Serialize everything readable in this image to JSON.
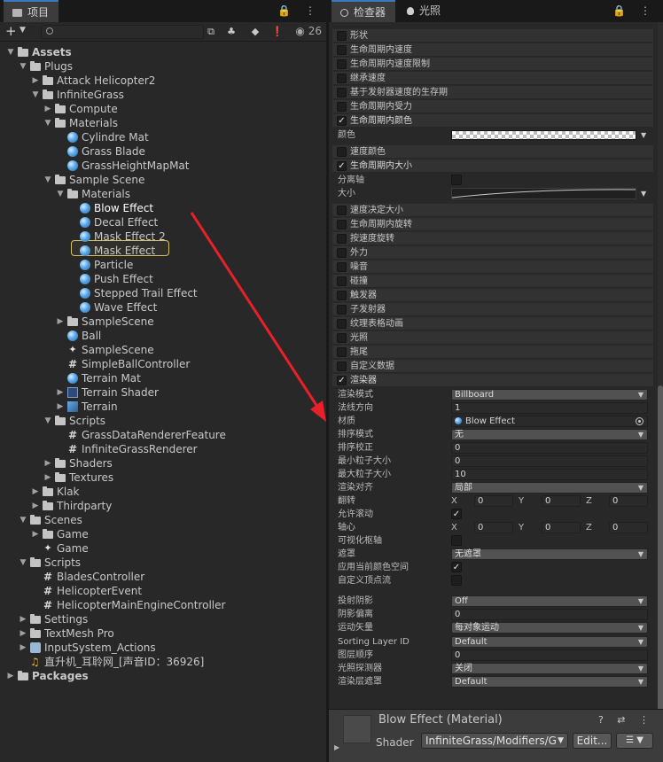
{
  "project": {
    "tab_label": "项目",
    "menu_glyphs": "🔒 ⋮",
    "search_placeholder": "",
    "eye_count": "26",
    "tree": [
      {
        "label": "Assets"
      },
      {
        "label": "Plugs"
      },
      {
        "label": "Attack Helicopter2"
      },
      {
        "label": "InfiniteGrass"
      },
      {
        "label": "Compute"
      },
      {
        "label": "Materials"
      },
      {
        "label": "Cylindre Mat"
      },
      {
        "label": "Grass Blade"
      },
      {
        "label": "GrassHeightMapMat"
      },
      {
        "label": "Sample Scene"
      },
      {
        "label": "Materials"
      },
      {
        "label": "Blow Effect"
      },
      {
        "label": "Decal Effect"
      },
      {
        "label": "Mask Effect 2"
      },
      {
        "label": "Mask Effect"
      },
      {
        "label": "Particle"
      },
      {
        "label": "Push Effect"
      },
      {
        "label": "Stepped Trail Effect"
      },
      {
        "label": "Wave Effect"
      },
      {
        "label": "SampleScene"
      },
      {
        "label": "Ball"
      },
      {
        "label": "SampleScene"
      },
      {
        "label": "SimpleBallController"
      },
      {
        "label": "Terrain Mat"
      },
      {
        "label": "Terrain Shader"
      },
      {
        "label": "Terrain"
      },
      {
        "label": "Scripts"
      },
      {
        "label": "GrassDataRendererFeature"
      },
      {
        "label": "InfiniteGrassRenderer"
      },
      {
        "label": "Shaders"
      },
      {
        "label": "Textures"
      },
      {
        "label": "Klak"
      },
      {
        "label": "Thirdparty"
      },
      {
        "label": "Scenes"
      },
      {
        "label": "Game"
      },
      {
        "label": "Game"
      },
      {
        "label": "Scripts"
      },
      {
        "label": "BladesController"
      },
      {
        "label": "HelicopterEvent"
      },
      {
        "label": "HelicopterMainEngineController"
      },
      {
        "label": "Settings"
      },
      {
        "label": "TextMesh Pro"
      },
      {
        "label": "InputSystem_Actions"
      },
      {
        "label": "直升机_耳聆网_[声音ID：36926]"
      },
      {
        "label": "Packages"
      }
    ]
  },
  "inspector": {
    "tab_label": "检查器",
    "tab2_label": "光照",
    "menu_glyphs": "🔒 ⋮",
    "modules": [
      {
        "label": "形状",
        "checked": false
      },
      {
        "label": "生命周期内速度",
        "checked": false
      },
      {
        "label": "生命周期内速度限制",
        "checked": false
      },
      {
        "label": "继承速度",
        "checked": false
      },
      {
        "label": "基于发射器速度的生存期",
        "checked": false
      },
      {
        "label": "生命周期内受力",
        "checked": false
      },
      {
        "label": "生命周期内颜色",
        "checked": true
      },
      {
        "label": "速度颜色",
        "checked": false
      },
      {
        "label": "生命周期内大小",
        "checked": true
      },
      {
        "label": "速度决定大小",
        "checked": false
      },
      {
        "label": "生命周期内旋转",
        "checked": false
      },
      {
        "label": "按速度旋转",
        "checked": false
      },
      {
        "label": "外力",
        "checked": false
      },
      {
        "label": "噪音",
        "checked": false
      },
      {
        "label": "碰撞",
        "checked": false
      },
      {
        "label": "触发器",
        "checked": false
      },
      {
        "label": "子发射器",
        "checked": false
      },
      {
        "label": "纹理表格动画",
        "checked": false
      },
      {
        "label": "光照",
        "checked": false
      },
      {
        "label": "拖尾",
        "checked": false
      },
      {
        "label": "自定义数据",
        "checked": false
      },
      {
        "label": "渲染器",
        "checked": true
      }
    ],
    "color_label": "颜色",
    "separate_axes_label": "分离轴",
    "size_label": "大小",
    "renderer": {
      "render_mode_label": "渲染模式",
      "render_mode": "Billboard",
      "normal_dir_label": "法线方向",
      "normal_dir": "1",
      "material_label": "材质",
      "material": "Blow Effect",
      "sort_mode_label": "排序模式",
      "sort_mode": "无",
      "sort_fudge_label": "排序校正",
      "sort_fudge": "0",
      "min_size_label": "最小粒子大小",
      "min_size": "0",
      "max_size_label": "最大粒子大小",
      "max_size": "10",
      "align_label": "渲染对齐",
      "align": "局部",
      "flip_label": "翻转",
      "flip_x": "0",
      "flip_y": "0",
      "flip_z": "0",
      "allow_roll_label": "允许滚动",
      "pivot_label": "轴心",
      "pivot_x": "0",
      "pivot_y": "0",
      "pivot_z": "0",
      "visualize_pivot_label": "可视化枢轴",
      "masking_label": "遮罩",
      "masking": "无遮罩",
      "apply_color_space_label": "应用当前颜色空间",
      "custom_vertex_label": "自定义顶点流",
      "cast_shadows_label": "投射阴影",
      "cast_shadows": "Off",
      "shadow_bias_label": "阴影偏离",
      "shadow_bias": "0",
      "motion_vectors_label": "运动矢量",
      "motion_vectors": "每对象运动",
      "sorting_layer_label": "Sorting Layer ID",
      "sorting_layer": "Default",
      "order_in_layer_label": "图层顺序",
      "order_in_layer": "0",
      "light_probes_label": "光照探测器",
      "light_probes": "关闭",
      "rendering_layer_label": "渲染层遮罩",
      "rendering_layer": "Default"
    },
    "axis_x": "X",
    "axis_y": "Y",
    "axis_z": "Z"
  },
  "material_header": {
    "title": "Blow Effect (Material)",
    "icons": "? ⇄ ⋮",
    "shader_label": "Shader",
    "shader_value": "InfiniteGrass/Modifiers/Gr",
    "edit_label": "Edit...",
    "list_glyph": "☰"
  },
  "colors": {
    "selection_outline": "#d6c06a",
    "arrow": "#e8202a",
    "tab_accent": "#3a79bb"
  }
}
